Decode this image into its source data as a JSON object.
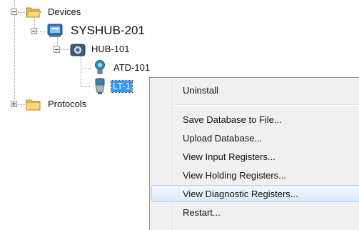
{
  "tree": {
    "devices": {
      "label": "Devices",
      "icon": "open-folder-icon"
    },
    "syshub": {
      "label": "SYSHUB-201",
      "icon": "hub-device-icon"
    },
    "hub": {
      "label": "HUB-101",
      "icon": "gear-device-icon"
    },
    "atd": {
      "label": "ATD-101",
      "icon": "transmitter-icon"
    },
    "lt": {
      "label": "LT-1",
      "icon": "level-transmitter-icon",
      "selected": true
    },
    "protocols": {
      "label": "Protocols",
      "icon": "closed-folder-icon"
    }
  },
  "context_menu": {
    "items": [
      {
        "label": "Uninstall"
      },
      {
        "label": "Save Database to File..."
      },
      {
        "label": "Upload Database..."
      },
      {
        "label": "View Input Registers..."
      },
      {
        "label": "View Holding Registers..."
      },
      {
        "label": "View Diagnostic Registers...",
        "highlighted": true
      },
      {
        "label": "Restart..."
      }
    ]
  },
  "colors": {
    "selection": "#3399ff",
    "menu_highlight": "#dbeaf8",
    "menu_background": "#f0f0f0"
  }
}
